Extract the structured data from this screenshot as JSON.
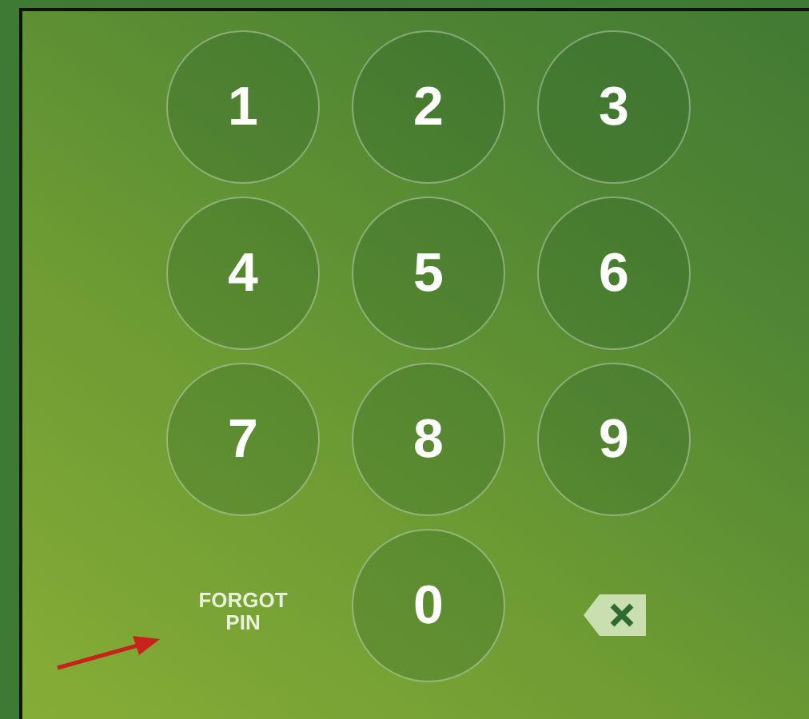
{
  "keypad": [
    {
      "kind": "digit",
      "label": "1"
    },
    {
      "kind": "digit",
      "label": "2"
    },
    {
      "kind": "digit",
      "label": "3"
    },
    {
      "kind": "digit",
      "label": "4"
    },
    {
      "kind": "digit",
      "label": "5"
    },
    {
      "kind": "digit",
      "label": "6"
    },
    {
      "kind": "digit",
      "label": "7"
    },
    {
      "kind": "digit",
      "label": "8"
    },
    {
      "kind": "digit",
      "label": "9"
    },
    {
      "kind": "forgot",
      "label": "FORGOT PIN"
    },
    {
      "kind": "digit",
      "label": "0"
    },
    {
      "kind": "delete"
    }
  ]
}
